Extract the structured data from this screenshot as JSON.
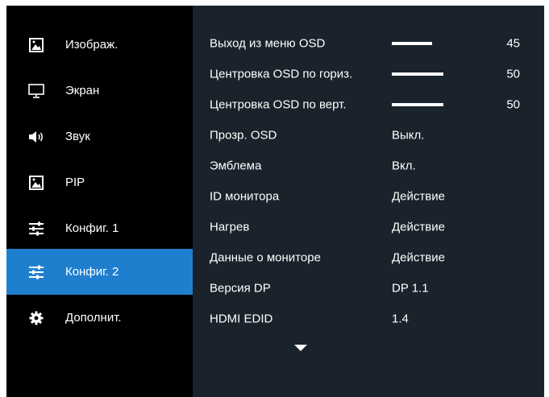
{
  "sidebar": {
    "items": [
      {
        "label": "Изображ.",
        "icon": "picture-icon",
        "selected": false
      },
      {
        "label": "Экран",
        "icon": "monitor-icon",
        "selected": false
      },
      {
        "label": "Звук",
        "icon": "speaker-icon",
        "selected": false
      },
      {
        "label": "PIP",
        "icon": "picture-in-picture-icon",
        "selected": false
      },
      {
        "label": "Конфиг. 1",
        "icon": "sliders-icon",
        "selected": false
      },
      {
        "label": "Конфиг. 2",
        "icon": "sliders-icon",
        "selected": true
      },
      {
        "label": "Дополнит.",
        "icon": "gear-icon",
        "selected": false
      }
    ]
  },
  "settings": [
    {
      "label": "Выход из меню OSD",
      "type": "slider",
      "value": 45
    },
    {
      "label": "Центровка OSD по гориз.",
      "type": "slider",
      "value": 50
    },
    {
      "label": "Центровка OSD по верт.",
      "type": "slider",
      "value": 50
    },
    {
      "label": "Прозр. OSD",
      "type": "option",
      "value": "Выкл."
    },
    {
      "label": "Эмблема",
      "type": "option",
      "value": "Вкл."
    },
    {
      "label": "ID монитора",
      "type": "option",
      "value": "Действие"
    },
    {
      "label": "Нагрев",
      "type": "option",
      "value": "Действие"
    },
    {
      "label": "Данные о мониторе",
      "type": "option",
      "value": "Действие"
    },
    {
      "label": "Версия DP",
      "type": "option",
      "value": "DP 1.1"
    },
    {
      "label": "HDMI EDID",
      "type": "option",
      "value": "1.4"
    }
  ],
  "scroll_indicator": "chevron-down-icon",
  "colors": {
    "selected": "#1f7fcf",
    "panel": "#1a232b",
    "sidebar": "#000000",
    "text": "#ffffff"
  }
}
